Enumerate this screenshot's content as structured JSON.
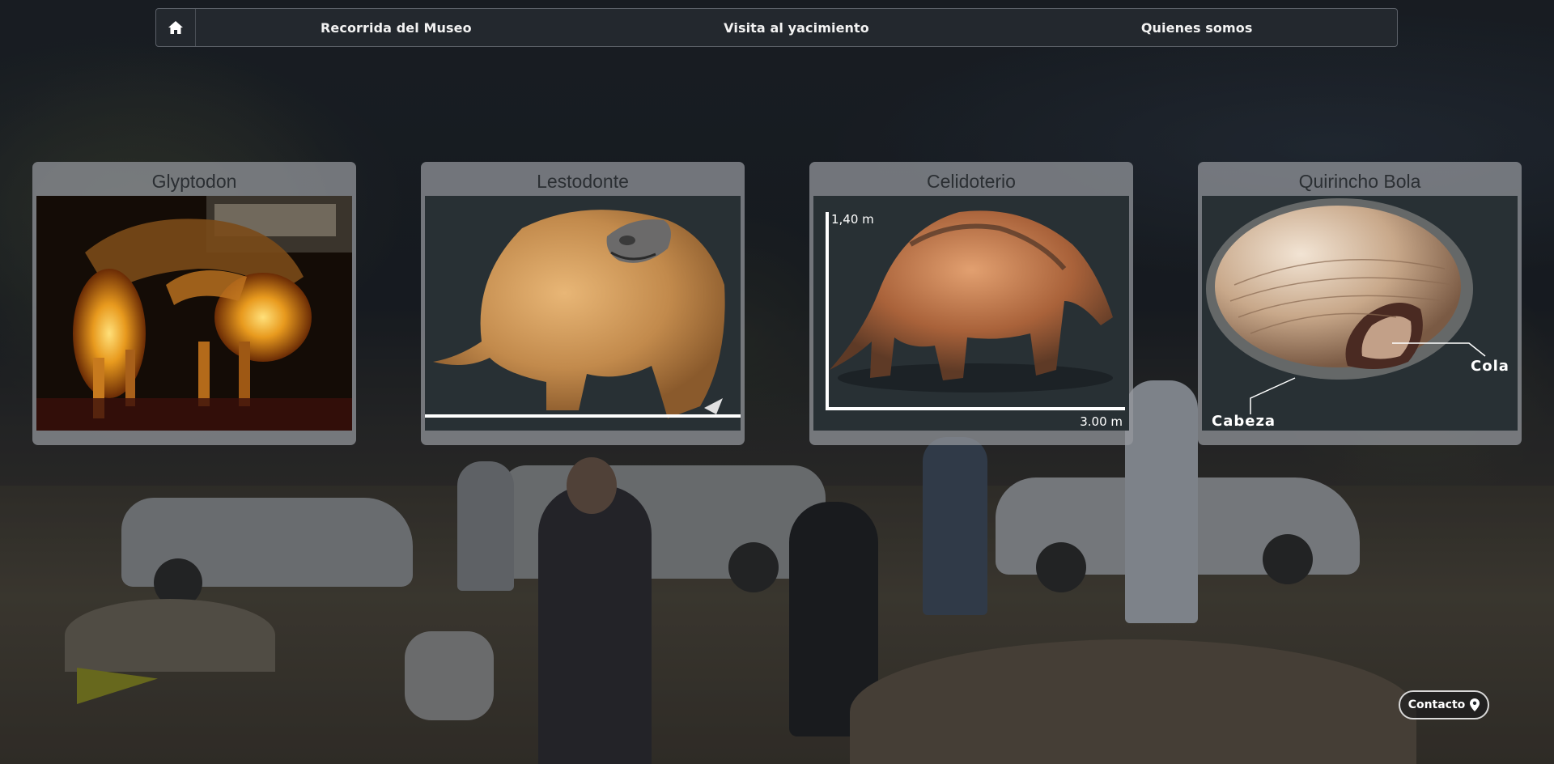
{
  "nav": {
    "home_icon": "home-icon",
    "links": [
      {
        "label": "Recorrida del Museo"
      },
      {
        "label": "Visita al yacimiento"
      },
      {
        "label": "Quienes somos"
      }
    ]
  },
  "cards": [
    {
      "title": "Glyptodon",
      "image": "glyptodon-skeleton-photo"
    },
    {
      "title": "Lestodonte",
      "image": "lestodonte-illustration",
      "scale_label": ""
    },
    {
      "title": "Celidoterio",
      "image": "celidoterio-illustration",
      "height_label": "1,40 m",
      "length_label": "3.00 m"
    },
    {
      "title": "Quirincho Bola",
      "image": "quirincho-bola-illustration",
      "label_tail": "Cola",
      "label_head": "Cabeza"
    }
  ],
  "contact": {
    "label": "Contacto",
    "icon": "location-pin-icon"
  },
  "colors": {
    "nav_bg": "#23282e",
    "card_bg": "#96999e",
    "card_title": "#2b2f33"
  }
}
